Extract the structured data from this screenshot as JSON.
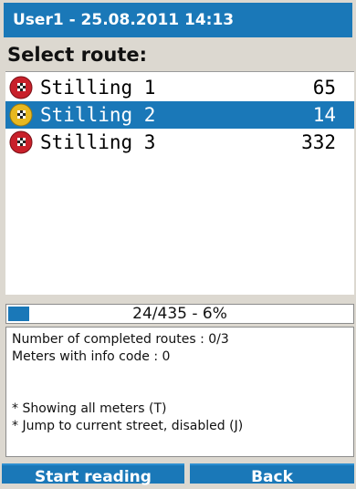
{
  "header": {
    "title": "User1 - 25.08.2011 14:13"
  },
  "page": {
    "title": "Select route:"
  },
  "routes": [
    {
      "name": "Stilling 1",
      "count": "65",
      "status_icon": "red-checkered-flag-icon",
      "selected": false
    },
    {
      "name": "Stilling 2",
      "count": "14",
      "status_icon": "yellow-checkered-flag-icon",
      "selected": true
    },
    {
      "name": "Stilling 3",
      "count": "332",
      "status_icon": "red-checkered-flag-icon",
      "selected": false
    }
  ],
  "progress": {
    "label": "24/435 - 6%",
    "fraction": 0.06
  },
  "info": {
    "completed_routes": "Number of completed routes : 0/3",
    "info_code": "Meters with info code : 0",
    "showing_all": "* Showing all meters (T)",
    "jump_street": "* Jump to current street, disabled (J)"
  },
  "buttons": {
    "start_label": "Start reading",
    "back_label": "Back"
  },
  "colors": {
    "accent": "#1a78b8",
    "route_red": "#c8202a",
    "route_yellow": "#e8b820"
  }
}
